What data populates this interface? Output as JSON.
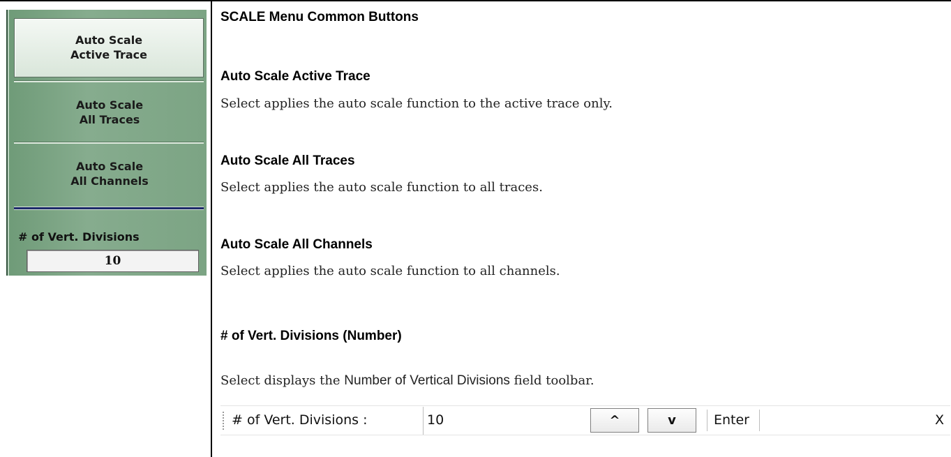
{
  "menu": {
    "buttons": [
      {
        "line1": "Auto Scale",
        "line2": "Active Trace"
      },
      {
        "line1": "Auto Scale",
        "line2": "All Traces"
      },
      {
        "line1": "Auto Scale",
        "line2": "All Channels"
      }
    ],
    "vert_divisions": {
      "label": "# of Vert. Divisions",
      "value": "10"
    }
  },
  "content": {
    "title": "SCALE Menu Common Buttons",
    "sections": [
      {
        "heading": "Auto Scale Active Trace",
        "text": "Select applies the auto scale function to the active trace only."
      },
      {
        "heading": "Auto Scale All Traces",
        "text": "Select applies the auto scale function to all traces."
      },
      {
        "heading": "Auto Scale All Channels",
        "text": "Select applies the auto scale function to all channels."
      },
      {
        "heading": "# of Vert. Divisions (Number)",
        "text_before": "Select displays the ",
        "text_emph": "Number of Vertical Divisions",
        "text_after": " field toolbar."
      }
    ]
  },
  "toolbar": {
    "label": "# of Vert. Divisions  :",
    "value": "10",
    "up_label": "^",
    "down_label": "v",
    "enter_label": "Enter",
    "close_label": "X"
  }
}
